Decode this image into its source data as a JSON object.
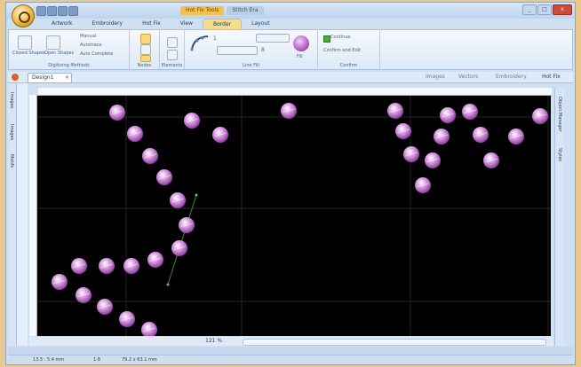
{
  "window": {
    "title_context": "Hot Fix Tools",
    "title_app": "Stitch Era"
  },
  "tabs": [
    {
      "label": "Artwork"
    },
    {
      "label": "Embroidery"
    },
    {
      "label": "Hot Fix"
    },
    {
      "label": "View"
    },
    {
      "label": "Border"
    },
    {
      "label": "Layout"
    }
  ],
  "ribbon": {
    "digitizing": {
      "closed_label": "Closed Shapes",
      "open_label": "Open Shapes",
      "manual": "Manual",
      "autotrace": "Autotrace",
      "auto_complete": "Auto Complete",
      "group_label": "Digitizing Methods"
    },
    "nodes_label": "Nodes",
    "elements_label": "Elements",
    "linefill": {
      "value1": "1",
      "value2": "8",
      "group_label": "Line Fill",
      "extra": "Fill"
    },
    "confirm": {
      "continue": "Continue",
      "confirm_edit": "Confirm and Edit",
      "group_label": "Confirm"
    }
  },
  "docbar": {
    "doc_tab": "Design1",
    "right_items": [
      "Images",
      "Vectors",
      "Embroidery",
      "Hot Fix"
    ]
  },
  "left_panel": {
    "tab1": "Images",
    "tab2": "Images",
    "tab3": "Motifs"
  },
  "right_panel": {
    "tab1": "Object Manager",
    "tab2": "Styles"
  },
  "zoom": {
    "value": "121 %"
  },
  "status": {
    "pos": "13.5 : 5.4 mm",
    "stitches": "1:8",
    "size": "79.2 x 63.1 mm"
  },
  "colors": {
    "canvas": "#000000",
    "bead": "#c77cd1",
    "accent": "#f3c24a"
  }
}
